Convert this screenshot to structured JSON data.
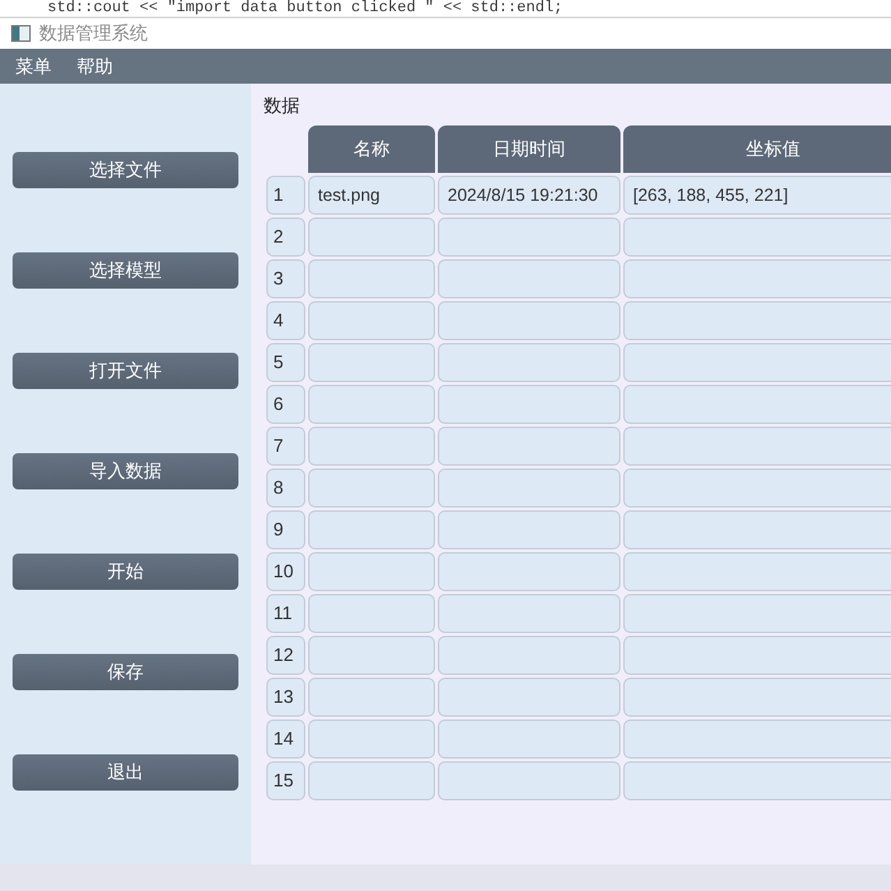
{
  "background_code_line": "std::cout << \"import data button clicked \" << std::endl;",
  "window": {
    "title": "数据管理系统"
  },
  "menu": [
    "菜单",
    "帮助"
  ],
  "sidebar_buttons": [
    "选择文件",
    "选择模型",
    "打开文件",
    "导入数据",
    "开始",
    "保存",
    "退出"
  ],
  "table_label": "数据",
  "table": {
    "columns": [
      "名称",
      "日期时间",
      "坐标值"
    ],
    "rows": [
      {
        "number": "1",
        "cells": [
          "test.png",
          "2024/8/15 19:21:30",
          "[263, 188, 455, 221]"
        ]
      },
      {
        "number": "2"
      },
      {
        "number": "3"
      },
      {
        "number": "4"
      },
      {
        "number": "5"
      },
      {
        "number": "6"
      },
      {
        "number": "7"
      },
      {
        "number": "8"
      },
      {
        "number": "9"
      },
      {
        "number": "10"
      },
      {
        "number": "11"
      },
      {
        "number": "12"
      },
      {
        "number": "13"
      },
      {
        "number": "14"
      },
      {
        "number": "15"
      }
    ]
  }
}
